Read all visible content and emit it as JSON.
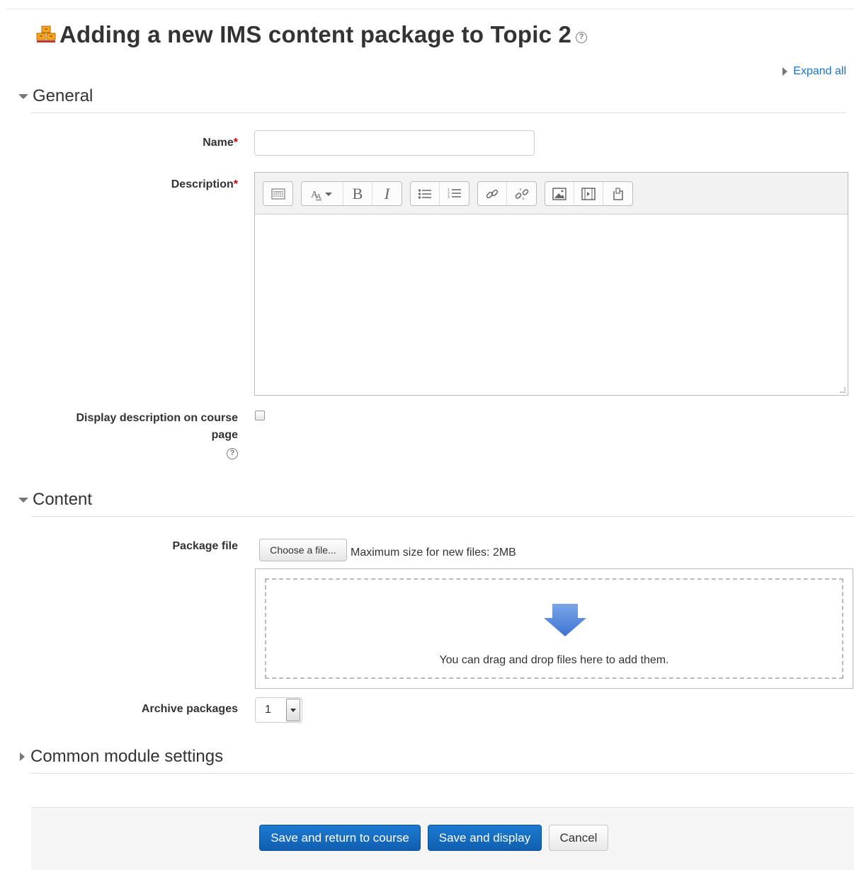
{
  "page": {
    "title": "Adding a new IMS content package to Topic 2",
    "expand_all": "Expand all"
  },
  "general": {
    "section_title": "General",
    "name_label": "Name",
    "name_value": "",
    "description_label": "Description",
    "required_marker": "*",
    "display_description_label": "Display description on course page",
    "display_description_checked": false,
    "toolbar": [
      [
        "toolbar-toggle-icon"
      ],
      [
        "font-style-icon",
        "bold-icon",
        "italic-icon"
      ],
      [
        "unordered-list-icon",
        "ordered-list-icon"
      ],
      [
        "link-icon",
        "unlink-icon"
      ],
      [
        "image-icon",
        "media-icon",
        "manage-files-icon"
      ]
    ]
  },
  "content": {
    "section_title": "Content",
    "package_file_label": "Package file",
    "choose_file_button": "Choose a file...",
    "max_size_text": "Maximum size for new files: 2MB",
    "drop_text": "You can drag and drop files here to add them.",
    "archive_packages_label": "Archive packages",
    "archive_packages_value": "1"
  },
  "common": {
    "section_title": "Common module settings"
  },
  "footer": {
    "save_return": "Save and return to course",
    "save_display": "Save and display",
    "cancel": "Cancel"
  },
  "colors": {
    "primary": "#0f65bf",
    "link": "#1a73c9",
    "required": "#cc0000"
  }
}
